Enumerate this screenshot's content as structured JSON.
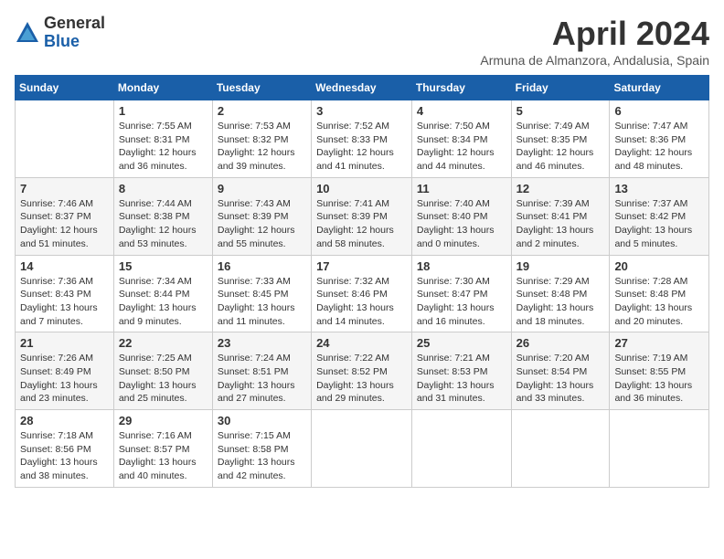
{
  "header": {
    "logo_general": "General",
    "logo_blue": "Blue",
    "title": "April 2024",
    "subtitle": "Armuna de Almanzora, Andalusia, Spain"
  },
  "columns": [
    "Sunday",
    "Monday",
    "Tuesday",
    "Wednesday",
    "Thursday",
    "Friday",
    "Saturday"
  ],
  "weeks": [
    [
      {
        "day": "",
        "info": ""
      },
      {
        "day": "1",
        "info": "Sunrise: 7:55 AM\nSunset: 8:31 PM\nDaylight: 12 hours\nand 36 minutes."
      },
      {
        "day": "2",
        "info": "Sunrise: 7:53 AM\nSunset: 8:32 PM\nDaylight: 12 hours\nand 39 minutes."
      },
      {
        "day": "3",
        "info": "Sunrise: 7:52 AM\nSunset: 8:33 PM\nDaylight: 12 hours\nand 41 minutes."
      },
      {
        "day": "4",
        "info": "Sunrise: 7:50 AM\nSunset: 8:34 PM\nDaylight: 12 hours\nand 44 minutes."
      },
      {
        "day": "5",
        "info": "Sunrise: 7:49 AM\nSunset: 8:35 PM\nDaylight: 12 hours\nand 46 minutes."
      },
      {
        "day": "6",
        "info": "Sunrise: 7:47 AM\nSunset: 8:36 PM\nDaylight: 12 hours\nand 48 minutes."
      }
    ],
    [
      {
        "day": "7",
        "info": "Sunrise: 7:46 AM\nSunset: 8:37 PM\nDaylight: 12 hours\nand 51 minutes."
      },
      {
        "day": "8",
        "info": "Sunrise: 7:44 AM\nSunset: 8:38 PM\nDaylight: 12 hours\nand 53 minutes."
      },
      {
        "day": "9",
        "info": "Sunrise: 7:43 AM\nSunset: 8:39 PM\nDaylight: 12 hours\nand 55 minutes."
      },
      {
        "day": "10",
        "info": "Sunrise: 7:41 AM\nSunset: 8:39 PM\nDaylight: 12 hours\nand 58 minutes."
      },
      {
        "day": "11",
        "info": "Sunrise: 7:40 AM\nSunset: 8:40 PM\nDaylight: 13 hours\nand 0 minutes."
      },
      {
        "day": "12",
        "info": "Sunrise: 7:39 AM\nSunset: 8:41 PM\nDaylight: 13 hours\nand 2 minutes."
      },
      {
        "day": "13",
        "info": "Sunrise: 7:37 AM\nSunset: 8:42 PM\nDaylight: 13 hours\nand 5 minutes."
      }
    ],
    [
      {
        "day": "14",
        "info": "Sunrise: 7:36 AM\nSunset: 8:43 PM\nDaylight: 13 hours\nand 7 minutes."
      },
      {
        "day": "15",
        "info": "Sunrise: 7:34 AM\nSunset: 8:44 PM\nDaylight: 13 hours\nand 9 minutes."
      },
      {
        "day": "16",
        "info": "Sunrise: 7:33 AM\nSunset: 8:45 PM\nDaylight: 13 hours\nand 11 minutes."
      },
      {
        "day": "17",
        "info": "Sunrise: 7:32 AM\nSunset: 8:46 PM\nDaylight: 13 hours\nand 14 minutes."
      },
      {
        "day": "18",
        "info": "Sunrise: 7:30 AM\nSunset: 8:47 PM\nDaylight: 13 hours\nand 16 minutes."
      },
      {
        "day": "19",
        "info": "Sunrise: 7:29 AM\nSunset: 8:48 PM\nDaylight: 13 hours\nand 18 minutes."
      },
      {
        "day": "20",
        "info": "Sunrise: 7:28 AM\nSunset: 8:48 PM\nDaylight: 13 hours\nand 20 minutes."
      }
    ],
    [
      {
        "day": "21",
        "info": "Sunrise: 7:26 AM\nSunset: 8:49 PM\nDaylight: 13 hours\nand 23 minutes."
      },
      {
        "day": "22",
        "info": "Sunrise: 7:25 AM\nSunset: 8:50 PM\nDaylight: 13 hours\nand 25 minutes."
      },
      {
        "day": "23",
        "info": "Sunrise: 7:24 AM\nSunset: 8:51 PM\nDaylight: 13 hours\nand 27 minutes."
      },
      {
        "day": "24",
        "info": "Sunrise: 7:22 AM\nSunset: 8:52 PM\nDaylight: 13 hours\nand 29 minutes."
      },
      {
        "day": "25",
        "info": "Sunrise: 7:21 AM\nSunset: 8:53 PM\nDaylight: 13 hours\nand 31 minutes."
      },
      {
        "day": "26",
        "info": "Sunrise: 7:20 AM\nSunset: 8:54 PM\nDaylight: 13 hours\nand 33 minutes."
      },
      {
        "day": "27",
        "info": "Sunrise: 7:19 AM\nSunset: 8:55 PM\nDaylight: 13 hours\nand 36 minutes."
      }
    ],
    [
      {
        "day": "28",
        "info": "Sunrise: 7:18 AM\nSunset: 8:56 PM\nDaylight: 13 hours\nand 38 minutes."
      },
      {
        "day": "29",
        "info": "Sunrise: 7:16 AM\nSunset: 8:57 PM\nDaylight: 13 hours\nand 40 minutes."
      },
      {
        "day": "30",
        "info": "Sunrise: 7:15 AM\nSunset: 8:58 PM\nDaylight: 13 hours\nand 42 minutes."
      },
      {
        "day": "",
        "info": ""
      },
      {
        "day": "",
        "info": ""
      },
      {
        "day": "",
        "info": ""
      },
      {
        "day": "",
        "info": ""
      }
    ]
  ]
}
